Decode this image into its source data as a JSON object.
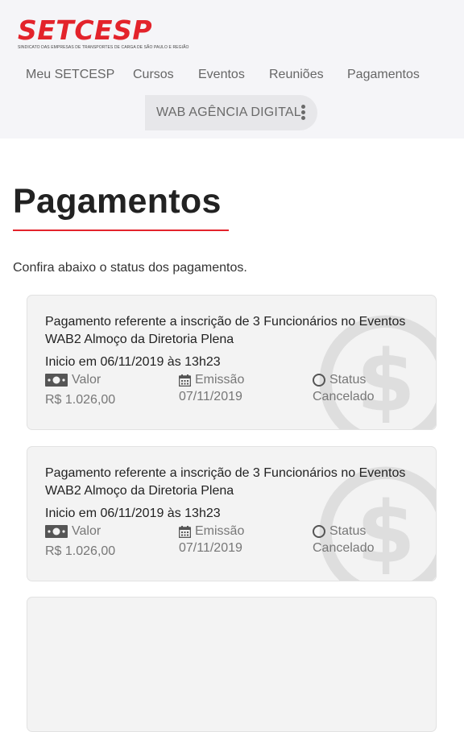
{
  "header": {
    "logo_text": "SETCESP",
    "logo_subtitle": "SINDICATO DAS EMPRESAS DE TRANSPORTES DE CARGA DE SÃO PAULO E REGIÃO",
    "brand_color": "#e3232b",
    "nav": [
      "Meu SETCESP",
      "Cursos",
      "Eventos",
      "Reuniões",
      "Pagamentos"
    ],
    "company_button": "WAB AGÊNCIA DIGITAL",
    "company_menu_icon": "kebab-menu-icon"
  },
  "main": {
    "title": "Pagamentos",
    "intro": "Confira abaixo o status dos pagamentos."
  },
  "labels": {
    "valor": "Valor",
    "emissao": "Emissão",
    "status": "Status"
  },
  "payments": [
    {
      "title": "Pagamento referente a inscrição de 3 Funcionários no Eventos WAB2 Almoço da Diretoria Plena",
      "start": "Inicio em 06/11/2019 às 13h23",
      "valor": "R$ 1.026,00",
      "emissao": "07/11/2019",
      "status": "Cancelado"
    },
    {
      "title": "Pagamento referente a inscrição de 3 Funcionários no Eventos WAB2 Almoço da Diretoria Plena",
      "start": "Inicio em 06/11/2019 às 13h23",
      "valor": "R$ 1.026,00",
      "emissao": "07/11/2019",
      "status": "Cancelado"
    }
  ]
}
